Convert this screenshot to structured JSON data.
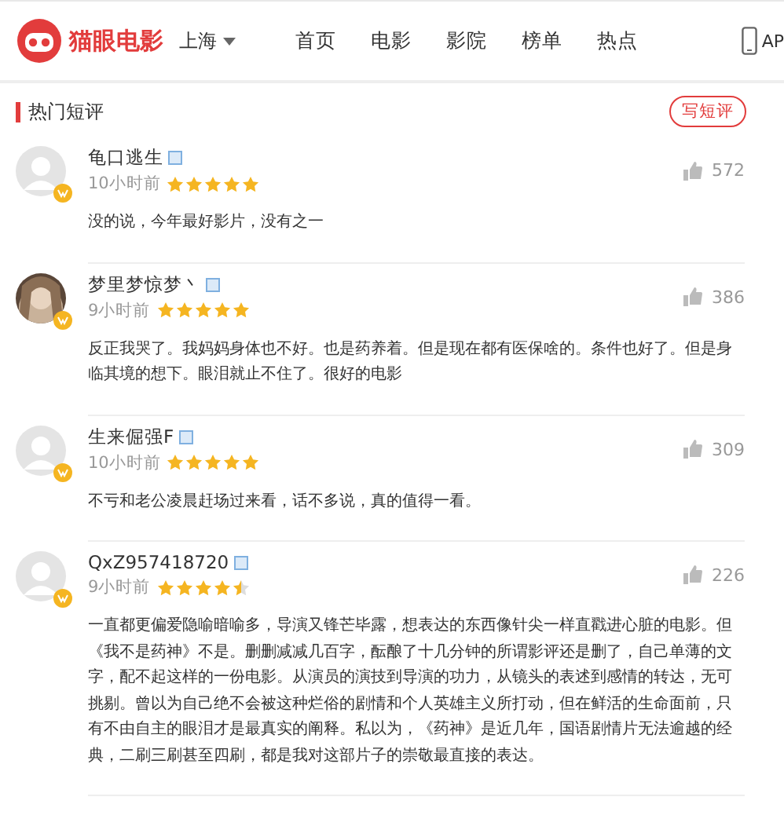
{
  "header": {
    "logo_text": "猫眼电影",
    "city": "上海",
    "nav": [
      {
        "label": "首页",
        "selected": false
      },
      {
        "label": "电影",
        "selected": false
      },
      {
        "label": "影院",
        "selected": false
      },
      {
        "label": "榜单",
        "selected": false
      },
      {
        "label": "热点",
        "selected": false
      }
    ],
    "app_label": "AP"
  },
  "section": {
    "title": "热门短评",
    "write_button": "写短评"
  },
  "comments": [
    {
      "user": "龟口逃生",
      "avatar": {
        "kind": "default"
      },
      "time": "10小时前",
      "stars": 5,
      "likes": "572",
      "text": "没的说，今年最好影片，没有之一"
    },
    {
      "user": "梦里梦惊梦丶",
      "time": "9小时前",
      "stars": 5,
      "likes": "386",
      "text": "反正我哭了。我妈妈身体也不好。也是药养着。但是现在都有医保啥的。条件也好了。但是身临其境的想下。眼泪就止不住了。很好的电影"
    },
    {
      "user": "生来倔强F",
      "avatar": {
        "kind": "default"
      },
      "time": "10小时前",
      "stars": 5,
      "likes": "309",
      "text": "不亏和老公凌晨赶场过来看，话不多说，真的值得一看。"
    },
    {
      "user": "QxZ957418720",
      "avatar": {
        "kind": "default"
      },
      "time": "9小时前",
      "stars": 4.5,
      "likes": "226",
      "text": "一直都更偏爱隐喻暗喻多，导演又锋芒毕露，想表达的东西像针尖一样直戳进心脏的电影。但《我不是药神》不是。删删减减几百字，酝酿了十几分钟的所谓影评还是删了，自己单薄的文字，配不起这样的一份电影。从演员的演技到导演的功力，从镜头的表述到感情的转达，无可挑剔。曾以为自己绝不会被这种烂俗的剧情和个人英雄主义所打动，但在鲜活的生命面前，只有不由自主的眼泪才是最真实的阐释。私以为，《药神》是近几年，国语剧情片无法逾越的经典，二刷三刷甚至四刷，都是我对这部片子的崇敬最直接的表达。"
    }
  ]
}
